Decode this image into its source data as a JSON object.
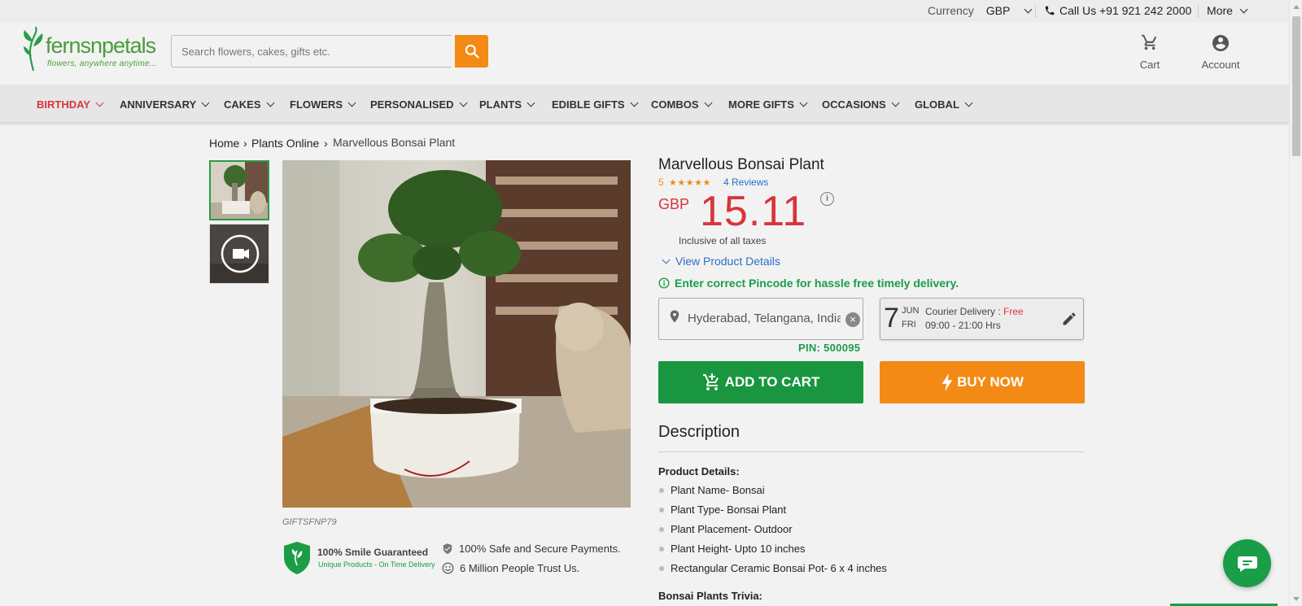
{
  "topbar": {
    "currency_label": "Currency",
    "currency_value": "GBP",
    "call_label": "Call Us +91 921 242 2000",
    "more_label": "More"
  },
  "header": {
    "logo_brand": "fernsnpetals",
    "logo_tagline": "flowers, anywhere anytime...",
    "search_placeholder": "Search flowers, cakes, gifts etc.",
    "cart_label": "Cart",
    "account_label": "Account"
  },
  "nav": {
    "items": [
      {
        "label": "BIRTHDAY"
      },
      {
        "label": "ANNIVERSARY"
      },
      {
        "label": "CAKES"
      },
      {
        "label": "FLOWERS"
      },
      {
        "label": "PERSONALISED"
      },
      {
        "label": "PLANTS"
      },
      {
        "label": "EDIBLE GIFTS"
      },
      {
        "label": "COMBOS"
      },
      {
        "label": "MORE GIFTS"
      },
      {
        "label": "OCCASIONS"
      },
      {
        "label": "GLOBAL"
      }
    ]
  },
  "breadcrumb": {
    "home": "Home",
    "category": "Plants Online",
    "current": "Marvellous Bonsai Plant"
  },
  "product": {
    "title": "Marvellous Bonsai Plant",
    "rating": "5",
    "stars": "★★★★★",
    "reviews": "4 Reviews",
    "currency": "GBP",
    "price": "15.11",
    "info_glyph": "i",
    "taxes": "Inclusive of all taxes",
    "view_details": "View Product Details",
    "pincode_msg": "Enter correct Pincode for hassle free timely delivery.",
    "location": "Hyderabad, Telangana, India",
    "pin": "PIN: 500095",
    "delivery_day": "7",
    "delivery_month": "JUN",
    "delivery_dow": "FRI",
    "delivery_type": "Courier Delivery : ",
    "delivery_cost": "Free",
    "delivery_hours": "09:00 - 21:00 Hrs",
    "add_to_cart": "ADD TO CART",
    "buy_now": "BUY NOW",
    "sku": "GIFTSFNP79"
  },
  "description": {
    "heading": "Description",
    "details_heading": "Product Details:",
    "details": [
      "Plant Name- Bonsai",
      "Plant Type- Bonsai Plant",
      "Plant Placement- Outdoor",
      "Plant Height- Upto 10 inches",
      "Rectangular Ceramic Bonsai Pot- 6 x 4 inches"
    ],
    "trivia_heading": "Bonsai Plants Trivia:"
  },
  "trust": {
    "smile_title": "100% Smile Guaranteed",
    "smile_sub": "Unique Products - On Time Delivery",
    "secure": "100% Safe and Secure Payments.",
    "million": "6 Million People Trust Us."
  },
  "colors": {
    "brand_green": "#1a9d47",
    "accent_orange": "#f28a15",
    "price_red": "#d9343b",
    "link_blue": "#2b6fc7"
  }
}
